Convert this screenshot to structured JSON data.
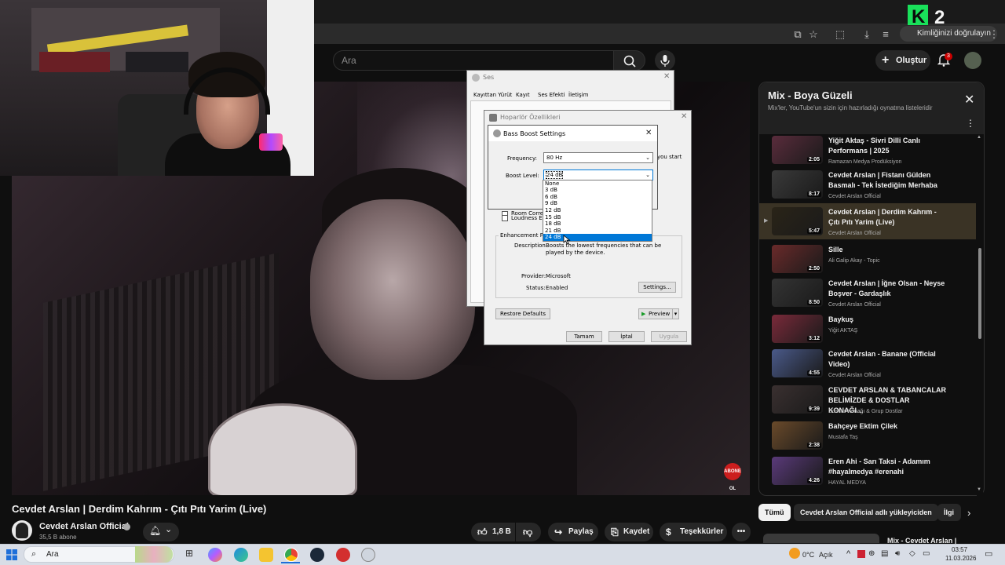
{
  "browser": {
    "verify_label": "Kimliğinizi doğrulayın",
    "overlay_logo": "K2"
  },
  "yt": {
    "search_placeholder": "Ara",
    "create_label": "Oluştur",
    "notif_count": "3"
  },
  "video": {
    "title": "Cevdet Arslan | Derdim Kahrım - Çıtı Pıtı Yarim (Live)",
    "channel": "Cevdet Arslan Official",
    "subscribers": "35,5 B abone",
    "likes": "1,8 B",
    "share_label": "Paylaş",
    "save_label": "Kaydet",
    "thanks_label": "Teşekkürler",
    "badge_text": "ABONE OL"
  },
  "playlist": {
    "title": "Mix - Boya Güzeli",
    "subtitle": "Mix'ler, YouTube'un sizin için hazırladığı oynatma listeleridir",
    "items": [
      {
        "title": "Yiğit Aktaş - Sivri Dilli Canlı Performans | 2025",
        "channel": "Ramazan Medya Prodüksiyon",
        "duration": "2:05",
        "color": "#5a2c3c"
      },
      {
        "title": "Cevdet Arslan | Fistanı Gülden Basmalı - Tek İstediğim Merhaba",
        "channel": "Cevdet Arslan Official",
        "duration": "8:17",
        "color": "#3a3a3a"
      },
      {
        "title": "Cevdet Arslan | Derdim Kahrım - Çıtı Pıtı Yarim (Live)",
        "channel": "Cevdet Arslan Official",
        "duration": "5:47",
        "color": "#2a2418",
        "active": true
      },
      {
        "title": "Sille",
        "channel": "Ali Galip Akay - Topic",
        "duration": "2:50",
        "color": "#6a2a2a"
      },
      {
        "title": "Cevdet Arslan | İğne Olsan - Neyse Boşver - Gardaşlık",
        "channel": "Cevdet Arslan Official",
        "duration": "8:50",
        "color": "#343434"
      },
      {
        "title": "Baykuş",
        "channel": "Yiğit AKTAŞ",
        "duration": "3:12",
        "color": "#7a2a3a"
      },
      {
        "title": "Cevdet Arslan - Banane (Official Video)",
        "channel": "Cevdet Arslan Official",
        "duration": "4:55",
        "color": "#4a5a8a"
      },
      {
        "title": "CEVDET ARSLAN & TABANCALAR BELİMİZDE & DOSTLAR KONAĞI…",
        "channel": "Dostlar Konağı & Grup Dostlar",
        "duration": "9:39",
        "color": "#3a3030"
      },
      {
        "title": "Bahçeye Ektim Çilek",
        "channel": "Mustafa Taş",
        "duration": "2:38",
        "color": "#6a4a2a"
      },
      {
        "title": "Eren Ahi - Sarı Taksi - Adamım #hayalmedya #erenahi",
        "channel": "HAYAL MEDYA",
        "duration": "4:26",
        "color": "#5a3a7a"
      }
    ],
    "next_mix": "Mix - Cevdet Arslan |"
  },
  "chips": [
    "Tümü",
    "Cevdet Arslan Official adlı yükleyiciden",
    "İlgi"
  ],
  "ses_dialog": {
    "title": "Ses",
    "tabs": [
      "Kayıttan Yürüt",
      "Kayıt",
      "Ses Efekti",
      "İletişim"
    ]
  },
  "hoparlor_dialog": {
    "title": "Hoparlör Özellikleri",
    "enhancement_label": "Enhancement Pro",
    "loudness_label": "Loudness Eq",
    "room_label": "Room Corre",
    "description_label": "Description:",
    "description_text": "Boosts the lowest frequencies that can be played by the device.",
    "provider_label": "Provider:",
    "provider_value": "Microsoft",
    "status_label": "Status:",
    "status_value": "Enabled",
    "settings_btn": "Settings...",
    "restore_btn": "Restore Defaults",
    "preview_btn": "Preview",
    "ok_btn": "Tamam",
    "cancel_btn": "İptal",
    "apply_btn": "Uygula",
    "you_start": "you start"
  },
  "bass_dialog": {
    "title": "Bass Boost Settings",
    "frequency_label": "Frequency:",
    "frequency_value": "80 Hz",
    "boost_label": "Boost Level:",
    "boost_value": "24 dB",
    "options": [
      "None",
      "3 dB",
      "6 dB",
      "9 dB",
      "12 dB",
      "15 dB",
      "18 dB",
      "21 dB",
      "24 dB"
    ]
  },
  "taskbar": {
    "search": "Ara",
    "weather": "0°C",
    "weather_desc": "Açık",
    "time": "03:57",
    "date": "11.03.2026"
  }
}
